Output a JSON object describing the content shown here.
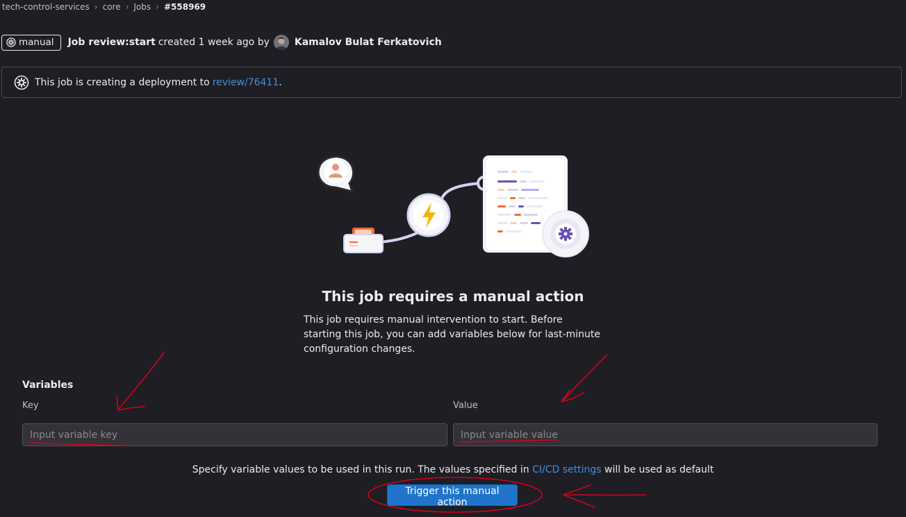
{
  "breadcrumb": {
    "items": [
      "tech-control-services",
      "core",
      "Jobs"
    ],
    "current": "#558969"
  },
  "job": {
    "status_badge": "manual",
    "prefix": "Job",
    "name": "review:start",
    "created_text": "created 1 week ago by",
    "author": "Kamalov Bulat Ferkatovich"
  },
  "deployment_alert": {
    "text": "This job is creating a deployment to",
    "link": "review/76411",
    "suffix": "."
  },
  "empty_state": {
    "title": "This job requires a manual action",
    "description": "This job requires manual intervention to start. Before starting this job, you can add variables below for last-minute configuration changes."
  },
  "variables": {
    "title": "Variables",
    "key_label": "Key",
    "value_label": "Value",
    "key_placeholder": "Input variable key",
    "value_placeholder": "Input variable value"
  },
  "help": {
    "text_before": "Specify variable values to be used in this run. The values specified in",
    "link": "CI/CD settings",
    "text_after": "will be used as default"
  },
  "trigger_button": "Trigger this manual action",
  "icons": {
    "status": "gear-icon",
    "alert": "gear-icon"
  },
  "colors": {
    "background": "#1f1e24",
    "link": "#428fdc",
    "button": "#1f75cb",
    "annotation": "#d0021b"
  }
}
